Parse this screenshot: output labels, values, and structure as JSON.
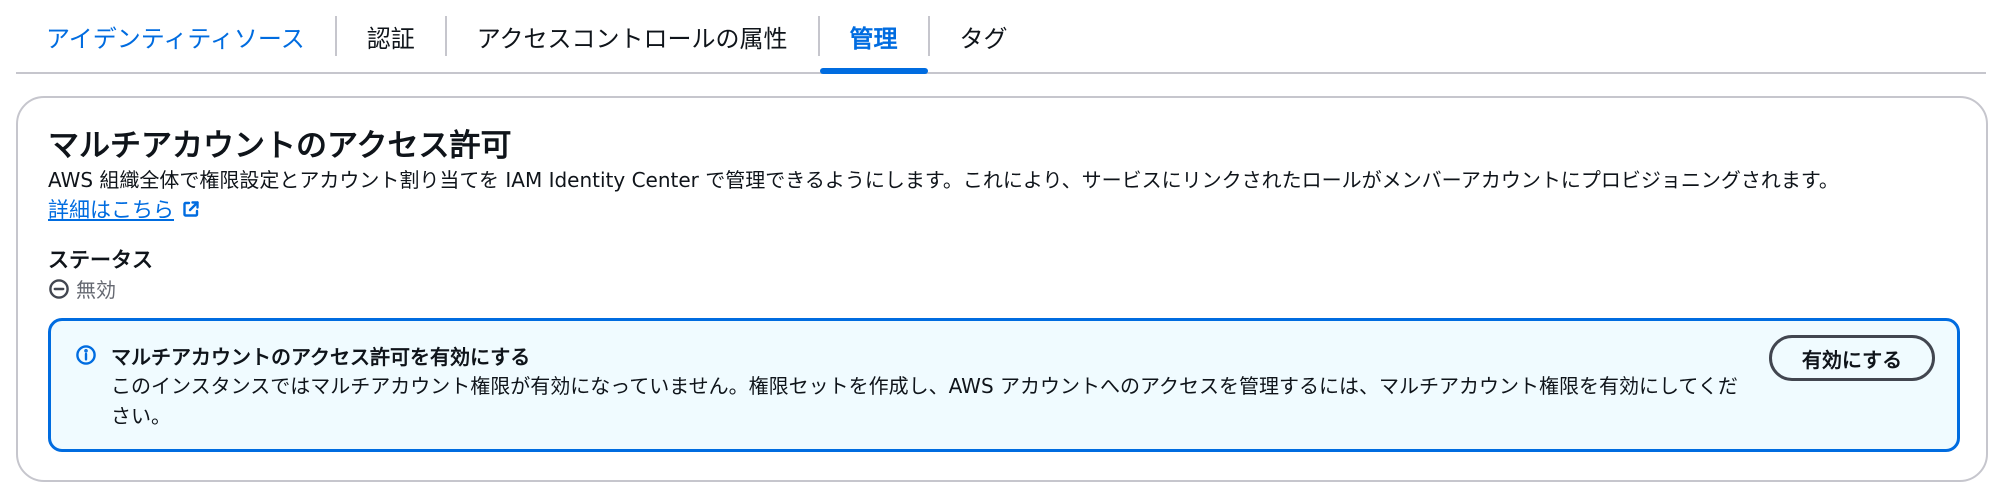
{
  "tabs": [
    {
      "label": "アイデンティティソース"
    },
    {
      "label": "認証"
    },
    {
      "label": "アクセスコントロールの属性"
    },
    {
      "label": "管理",
      "selected": true
    },
    {
      "label": "タグ"
    }
  ],
  "section": {
    "title": "マルチアカウントのアクセス許可",
    "description": "AWS 組織全体で権限設定とアカウント割り当てを IAM Identity Center で管理できるようにします。これにより、サービスにリンクされたロールがメンバーアカウントにプロビジョニングされます。",
    "learn_more": "詳細はこちら",
    "status_label": "ステータス",
    "status_value": "無効"
  },
  "alert": {
    "title": "マルチアカウントのアクセス許可を有効にする",
    "body": "このインスタンスではマルチアカウント権限が有効になっていません。権限セットを作成し、AWS アカウントへのアクセスを管理するには、マルチアカウント権限を有効にしてください。",
    "button_label": "有効にする"
  },
  "icons": {
    "external_link": "external-link-icon",
    "status": "minus-circle-icon",
    "info": "info-icon"
  },
  "colors": {
    "accent": "#006ce0",
    "text": "#0f141a",
    "muted": "#656871",
    "border": "#c6c6cd",
    "alert_bg": "#f0fbff"
  }
}
